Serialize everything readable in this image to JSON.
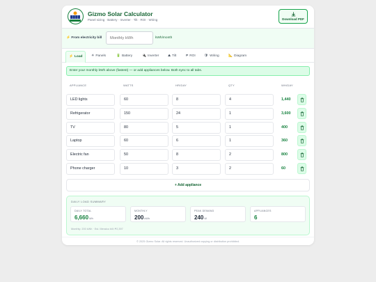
{
  "app": {
    "title": "Gizmo Solar Calculator",
    "subtitle": "Panel sizing · Battery · Inverter · Tilt · ROI · Wiring",
    "logo_text": "GIZMO SOLAR",
    "download_label": "Download PDF"
  },
  "electricity": {
    "label": "From electricity bill",
    "placeholder": "Monthly kWh",
    "unit": "kWh/month"
  },
  "tabs": [
    {
      "icon": "⚡",
      "label": "Load",
      "active": true
    },
    {
      "icon": "☀",
      "label": "Panels"
    },
    {
      "icon": "🔋",
      "label": "Battery"
    },
    {
      "icon": "🔌",
      "label": "Inverter"
    },
    {
      "icon": "⛰",
      "label": "Tilt"
    },
    {
      "icon": "₱",
      "label": "ROI"
    },
    {
      "icon": "🛡",
      "label": "Wiring"
    },
    {
      "icon": "📐",
      "label": "Diagram"
    }
  ],
  "info_banner": "Enter your monthly kWh above (fastest) — or add appliances below. Both sync to all tabs.",
  "table": {
    "headers": [
      "APPLIANCE",
      "WATTS",
      "HR/DAY",
      "QTY",
      "WH/DAY"
    ],
    "rows": [
      {
        "name": "LED lights",
        "watts": "60",
        "hours": "8",
        "qty": "4",
        "whday": "1,440"
      },
      {
        "name": "Refrigerator",
        "watts": "150",
        "hours": "24",
        "qty": "1",
        "whday": "3,600"
      },
      {
        "name": "TV",
        "watts": "80",
        "hours": "5",
        "qty": "1",
        "whday": "400"
      },
      {
        "name": "Laptop",
        "watts": "60",
        "hours": "6",
        "qty": "1",
        "whday": "360"
      },
      {
        "name": "Electric fan",
        "watts": "50",
        "hours": "8",
        "qty": "2",
        "whday": "800"
      },
      {
        "name": "Phone charger",
        "watts": "10",
        "hours": "3",
        "qty": "2",
        "whday": "60"
      }
    ]
  },
  "add_label": "+ Add appliance",
  "summary": {
    "title": "DAILY LOAD SUMMARY",
    "daily": {
      "label": "DAILY TOTAL",
      "value": "6,660",
      "unit": "Wh"
    },
    "monthly": {
      "label": "MONTHLY",
      "value": "200",
      "unit": "kWh"
    },
    "peak": {
      "label": "PEAK DEMAND",
      "value": "240",
      "unit": "W"
    },
    "appliances": {
      "label": "APPLIANCES",
      "value": "6"
    },
    "footnote": "Monthly: 200 kWh · Est. Meralco bill: ₱2,397"
  },
  "footer": "© 2025 Gizmo Solar. All rights reserved. Unauthorized copying or distribution prohibited.",
  "colors": {
    "accent": "#16a34a",
    "accent_dark": "#166534",
    "accent_light": "#f0fdf4"
  }
}
